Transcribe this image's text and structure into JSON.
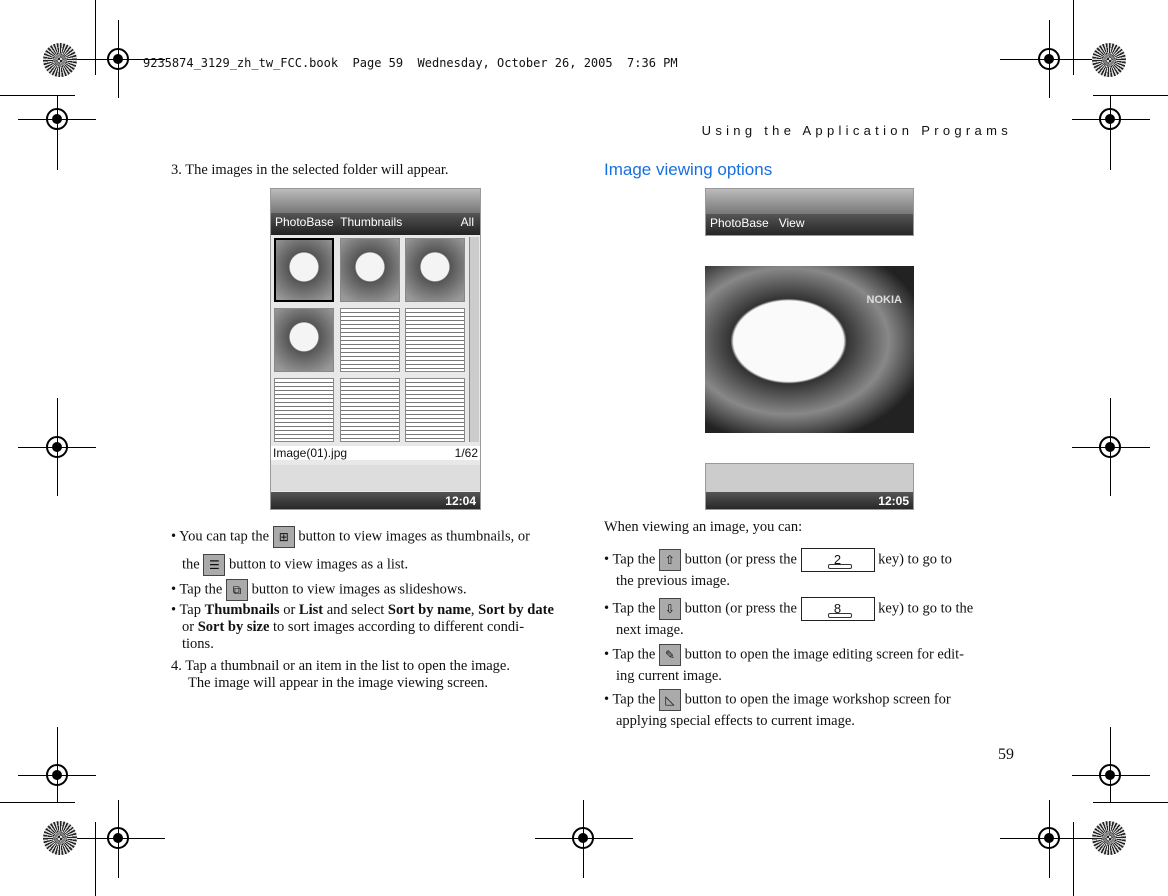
{
  "book_tag": "9235874_3129_zh_tw_FCC.book  Page 59  Wednesday, October 26, 2005  7:36 PM",
  "running_head": "Using the Application Programs",
  "page_number": "59",
  "left": {
    "step3": "3. The images in the selected folder will appear.",
    "screenshot": {
      "tabs": "PhotoBase  Thumbnails",
      "filter": "All",
      "filename": "Image(01).jpg",
      "count": "1/62",
      "clock": "12:04"
    },
    "b1_a": "• You can tap the",
    "b1_b": "button to view images as thumbnails, or",
    "b1_c": "the",
    "b1_d": "button to view images as a list.",
    "b2_a": "• Tap the",
    "b2_b": "button to view images as slideshows.",
    "b3_a": "• Tap ",
    "b3_thumbs": "Thumbnails",
    "b3_or": " or ",
    "b3_list": "List",
    "b3_sel": " and select ",
    "b3_name": "Sort by name",
    "b3_comma": ", ",
    "b3_date": "Sort by date",
    "b3_or2": "or ",
    "b3_size": "Sort by size",
    "b3_rest": " to sort images according to different condi-",
    "b3_end": "tions.",
    "step4_a": "4. Tap a thumbnail or an item in the list to open the image.",
    "step4_b": "The image will appear in the image viewing screen."
  },
  "right": {
    "heading": "Image viewing options",
    "screenshot": {
      "tabs": "PhotoBase   View",
      "brand": "NOKIA",
      "clock": "12:05"
    },
    "intro": "When viewing an image, you can:",
    "p1_a": "• Tap the",
    "p1_b": "button (or press the",
    "key2": "2",
    "p1_c": "key) to go to",
    "p1_d": "the previous image.",
    "p2_a": "• Tap the",
    "p2_b": "button (or press the",
    "key8": "8",
    "p2_c": "key) to go to the",
    "p2_d": "next image.",
    "p3_a": "• Tap the",
    "p3_b": "button to open the image editing screen for edit-",
    "p3_c": "ing current image.",
    "p4_a": "• Tap the",
    "p4_b": "button to open the image workshop screen for",
    "p4_c": "applying special effects to current image."
  }
}
